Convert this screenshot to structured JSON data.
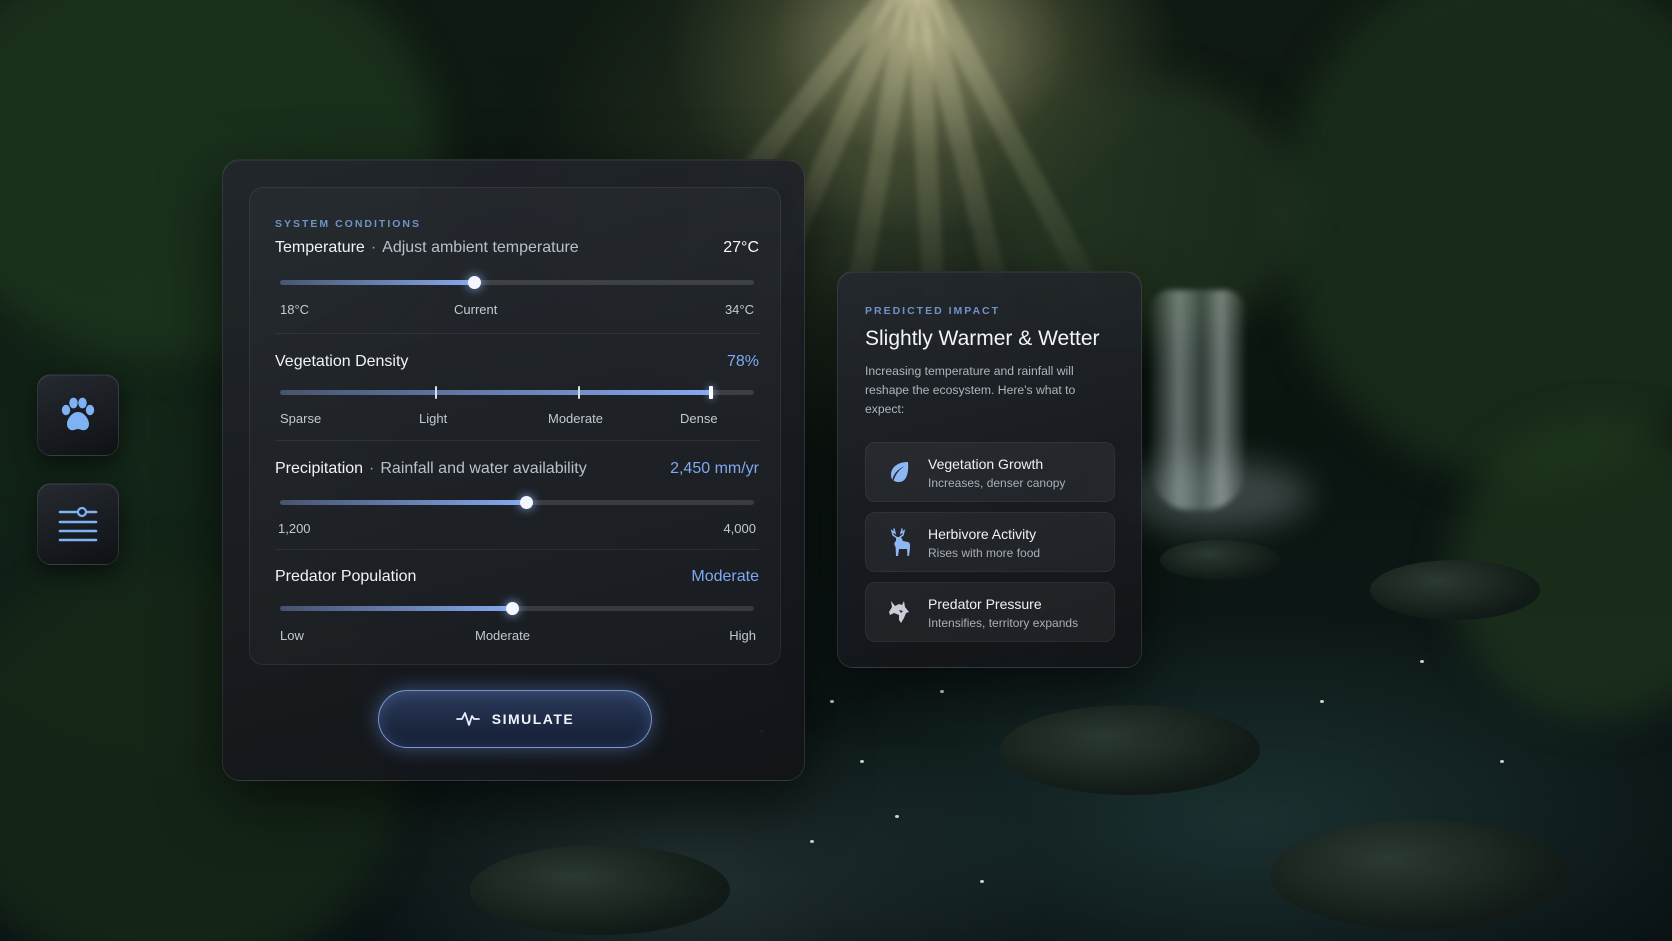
{
  "colors": {
    "accent": "#7fa8f0",
    "knob": "#f4f7ff",
    "eyebrow": "#6f93c9"
  },
  "sidebar": {
    "buttons": [
      {
        "icon": "paw-icon"
      },
      {
        "icon": "sliders-menu-icon"
      }
    ]
  },
  "conditions": {
    "eyebrow": "SYSTEM CONDITIONS",
    "temperature": {
      "title": "Temperature",
      "separator": "·",
      "subtitle": "Adjust ambient temperature",
      "value_text": "27°C",
      "level": 0.41,
      "labels": {
        "min": "18°C",
        "current": "Current",
        "max": "34°C"
      }
    },
    "vegetation": {
      "title": "Vegetation Density",
      "value_text": "78%",
      "level": 0.91,
      "stops": [
        "Sparse",
        "Light",
        "Moderate",
        "Dense"
      ],
      "selected_stop": "Dense"
    },
    "precipitation": {
      "title": "Precipitation",
      "separator": "·",
      "subtitle": "Rainfall and water availability",
      "value_text": "2,450 mm/yr",
      "level": 0.52,
      "labels": {
        "min": "1,200",
        "max": "4,000"
      }
    },
    "predator": {
      "title": "Predator Population",
      "value_text": "Moderate",
      "level": 0.49,
      "labels": {
        "low": "Low",
        "mid": "Moderate",
        "high": "High"
      }
    },
    "simulate_label": "SIMULATE",
    "simulate_icon": "pulse-icon"
  },
  "impact": {
    "eyebrow": "PREDICTED IMPACT",
    "title": "Slightly Warmer & Wetter",
    "description": "Increasing temperature and rainfall will reshape the ecosystem. Here's what to expect:",
    "items": [
      {
        "icon": "leaf-icon",
        "title": "Vegetation Growth",
        "subtitle": "Increases, denser canopy"
      },
      {
        "icon": "deer-icon",
        "title": "Herbivore Activity",
        "subtitle": "Rises with more food"
      },
      {
        "icon": "wolf-icon",
        "title": "Predator Pressure",
        "subtitle": "Intensifies, territory expands"
      }
    ]
  }
}
